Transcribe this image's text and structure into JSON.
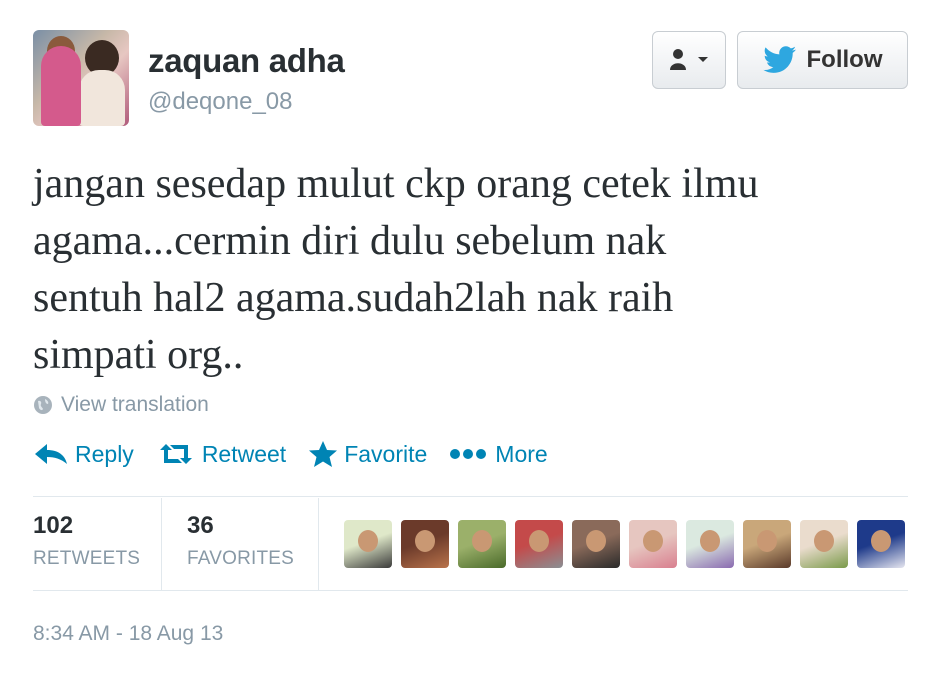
{
  "user": {
    "name": "zaquan adha",
    "handle": "@deqone_08"
  },
  "buttons": {
    "follow_label": "Follow"
  },
  "tweet": {
    "text_lines": [
      "jangan sesedap mulut ckp orang cetek ilmu",
      "agama...cermin diri dulu sebelum nak",
      "sentuh hal2 agama.sudah2lah nak raih",
      "simpati org.."
    ],
    "translation_label": "View translation"
  },
  "actions": {
    "reply": "Reply",
    "retweet": "Retweet",
    "favorite": "Favorite",
    "more": "More"
  },
  "stats": {
    "retweets": {
      "count": "102",
      "label": "RETWEETS"
    },
    "favorites": {
      "count": "36",
      "label": "FAVORITES"
    }
  },
  "favoriters": [
    {
      "name": "favoriter-1",
      "colors": [
        "#dfe8c9",
        "#3a3a3a"
      ]
    },
    {
      "name": "favoriter-2",
      "colors": [
        "#6b3a2a",
        "#b9734b"
      ]
    },
    {
      "name": "favoriter-3",
      "colors": [
        "#9bb06a",
        "#4a6a2a"
      ]
    },
    {
      "name": "favoriter-4",
      "colors": [
        "#c44a4a",
        "#8a8f93"
      ]
    },
    {
      "name": "favoriter-5",
      "colors": [
        "#8a6a5a",
        "#2a2a2a"
      ]
    },
    {
      "name": "favoriter-6",
      "colors": [
        "#e6c6c0",
        "#d97f8f"
      ]
    },
    {
      "name": "favoriter-7",
      "colors": [
        "#dbe9e0",
        "#8a6ab0"
      ]
    },
    {
      "name": "favoriter-8",
      "colors": [
        "#c9a77a",
        "#5a3a2a"
      ]
    },
    {
      "name": "favoriter-9",
      "colors": [
        "#eadccd",
        "#7a9a4a"
      ]
    },
    {
      "name": "favoriter-10",
      "colors": [
        "#1e3a8a",
        "#e6e6f0"
      ]
    }
  ],
  "timestamp": "8:34 AM - 18 Aug 13",
  "colors": {
    "link_blue": "#0084b4",
    "twitter_bird": "#2ea7e0",
    "muted": "#8899a6"
  }
}
